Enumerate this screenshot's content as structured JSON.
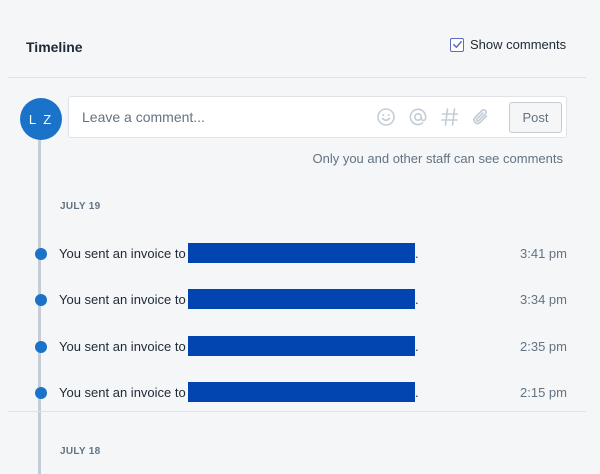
{
  "timeline": {
    "title": "Timeline",
    "show_comments_label": "Show comments",
    "show_comments_checked": true
  },
  "comment": {
    "avatar_initials": "L Z",
    "placeholder": "Leave a comment...",
    "tool_icons": [
      "smiley-icon",
      "at-mention-icon",
      "hashtag-icon",
      "paperclip-icon"
    ],
    "post_label": "Post",
    "helper_text": "Only you and other staff can see comments"
  },
  "groups": [
    {
      "date": "JULY 19",
      "events": [
        {
          "text": "You sent an invoice to",
          "suffix": ".",
          "time": "3:41 pm"
        },
        {
          "text": "You sent an invoice to",
          "suffix": ".",
          "time": "3:34 pm"
        },
        {
          "text": "You sent an invoice to",
          "suffix": ".",
          "time": "2:35 pm"
        },
        {
          "text": "You sent an invoice to",
          "suffix": ".",
          "time": "2:15 pm"
        }
      ]
    },
    {
      "date": "JULY 18",
      "events": []
    }
  ],
  "colors": {
    "accent": "#1a73c8",
    "redaction": "#0345b0",
    "checkbox": "#5c6ac4",
    "background": "#f4f6f8"
  }
}
